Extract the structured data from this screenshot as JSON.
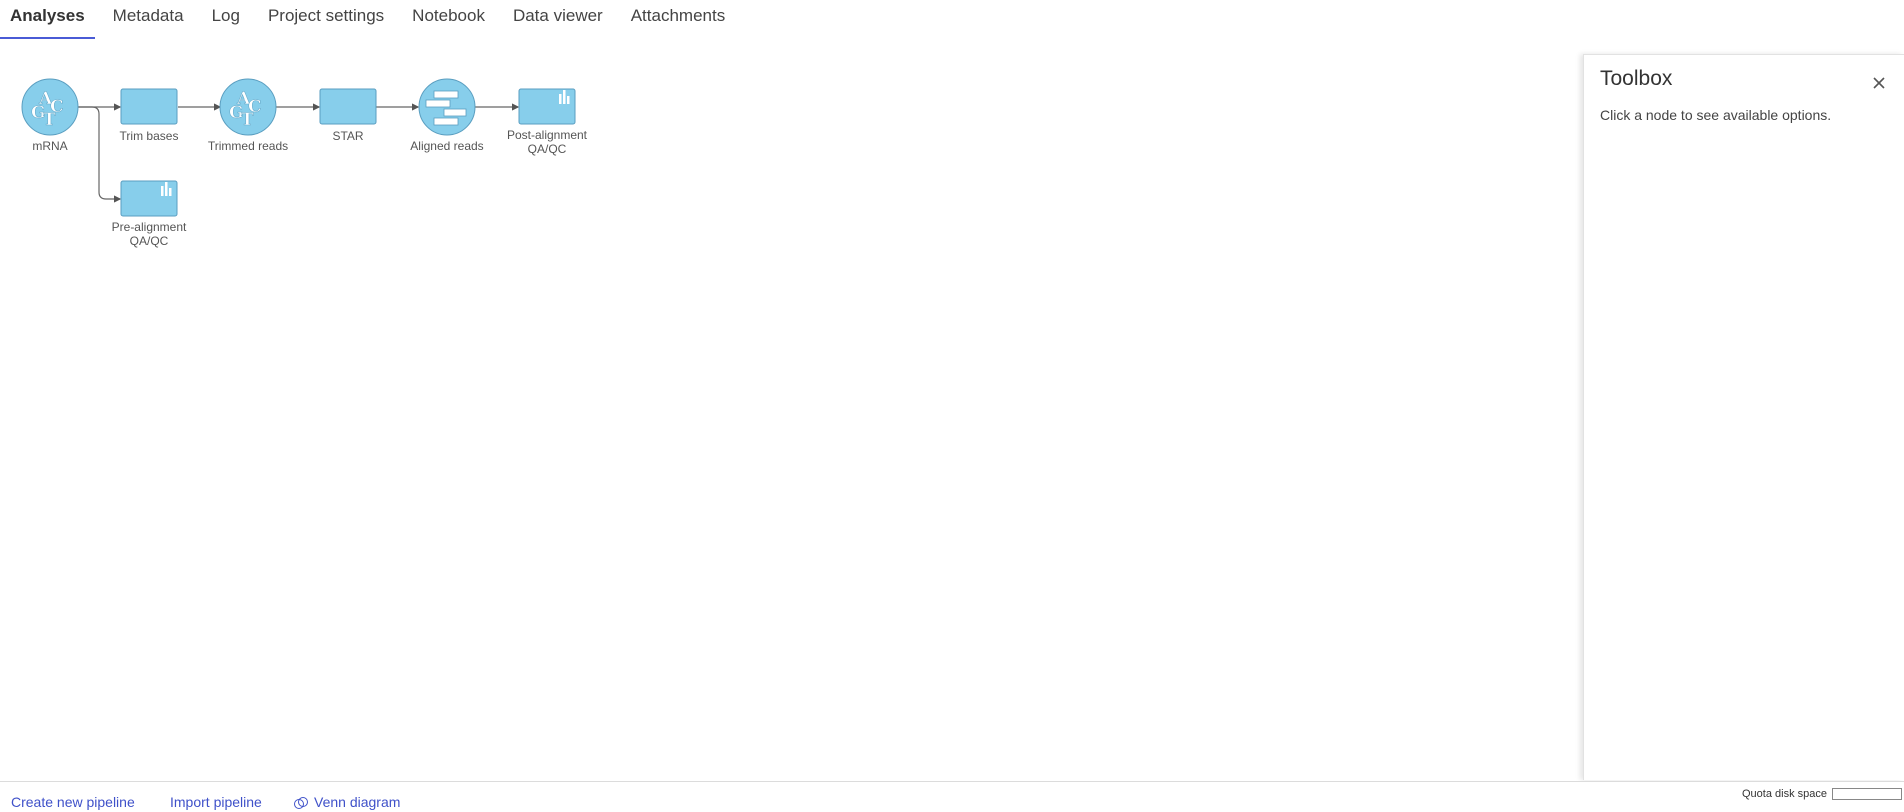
{
  "tabs": [
    {
      "label": "Analyses",
      "active": true
    },
    {
      "label": "Metadata"
    },
    {
      "label": "Log"
    },
    {
      "label": "Project settings"
    },
    {
      "label": "Notebook"
    },
    {
      "label": "Data viewer"
    },
    {
      "label": "Attachments"
    }
  ],
  "pipeline": {
    "nodes": [
      {
        "label": "mRNA",
        "type": "data",
        "icon": "sequence-data-icon"
      },
      {
        "label": "Trim bases",
        "type": "task",
        "icon": "task-icon"
      },
      {
        "label": "Trimmed reads",
        "type": "data",
        "icon": "sequence-data-icon"
      },
      {
        "label": "STAR",
        "type": "task",
        "icon": "task-icon"
      },
      {
        "label": "Aligned reads",
        "type": "data",
        "icon": "aligned-reads-icon"
      },
      {
        "label_line1": "Post-alignment",
        "label_line2": "QA/QC",
        "type": "task",
        "icon": "bar-chart-icon"
      },
      {
        "label_line1": "Pre-alignment",
        "label_line2": "QA/QC",
        "type": "task",
        "icon": "bar-chart-icon"
      }
    ],
    "node_color": "#87ceeb",
    "node_border": "#5a9ec0"
  },
  "toolbox": {
    "title": "Toolbox",
    "hint": "Click a node to see available options.",
    "close_icon": "close-icon"
  },
  "footer": {
    "create_label": "Create new pipeline",
    "import_label": "Import pipeline",
    "venn_label": "Venn diagram",
    "venn_icon": "venn-diagram-icon",
    "quota_label": "Quota disk space",
    "quota_fraction": 0,
    "link_color": "#3f51c9"
  }
}
